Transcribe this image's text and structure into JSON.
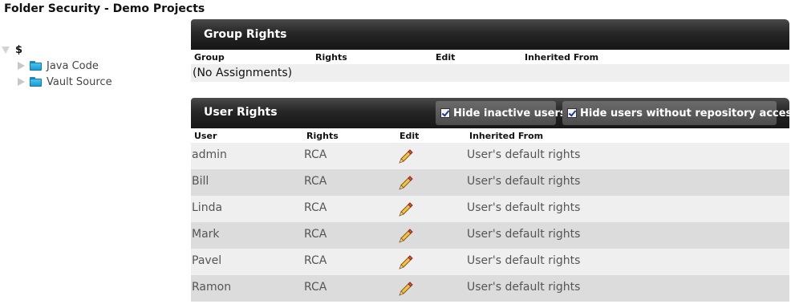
{
  "page_title": "Folder Security - Demo Projects",
  "tree": {
    "root": "$",
    "children": [
      "Java Code",
      "Vault Source"
    ]
  },
  "group_rights": {
    "title": "Group Rights",
    "columns": [
      "Group",
      "Rights",
      "Edit",
      "Inherited From"
    ],
    "empty_text": "(No Assignments)"
  },
  "user_rights": {
    "title": "User Rights",
    "filters": {
      "hide_inactive": {
        "label": "Hide inactive users",
        "checked": true
      },
      "hide_no_repo": {
        "label": "Hide users without repository access",
        "checked": true
      }
    },
    "columns": [
      "User",
      "Rights",
      "Edit",
      "Inherited From"
    ],
    "rows": [
      {
        "user": "admin",
        "rights": "RCA",
        "inherited": "User's default rights"
      },
      {
        "user": "Bill",
        "rights": "RCA",
        "inherited": "User's default rights"
      },
      {
        "user": "Linda",
        "rights": "RCA",
        "inherited": "User's default rights"
      },
      {
        "user": "Mark",
        "rights": "RCA",
        "inherited": "User's default rights"
      },
      {
        "user": "Pavel",
        "rights": "RCA",
        "inherited": "User's default rights"
      },
      {
        "user": "Ramon",
        "rights": "RCA",
        "inherited": "User's default rights"
      }
    ]
  },
  "icons": {
    "tree_folder": "folder-icon",
    "edit": "pencil-icon",
    "expand": "triangle-icon"
  },
  "colors": {
    "header_dark": "#1f1f1f",
    "folder_blue": "#2aa6dc",
    "row_light": "#efefef",
    "row_dark": "#dcdcdc"
  }
}
